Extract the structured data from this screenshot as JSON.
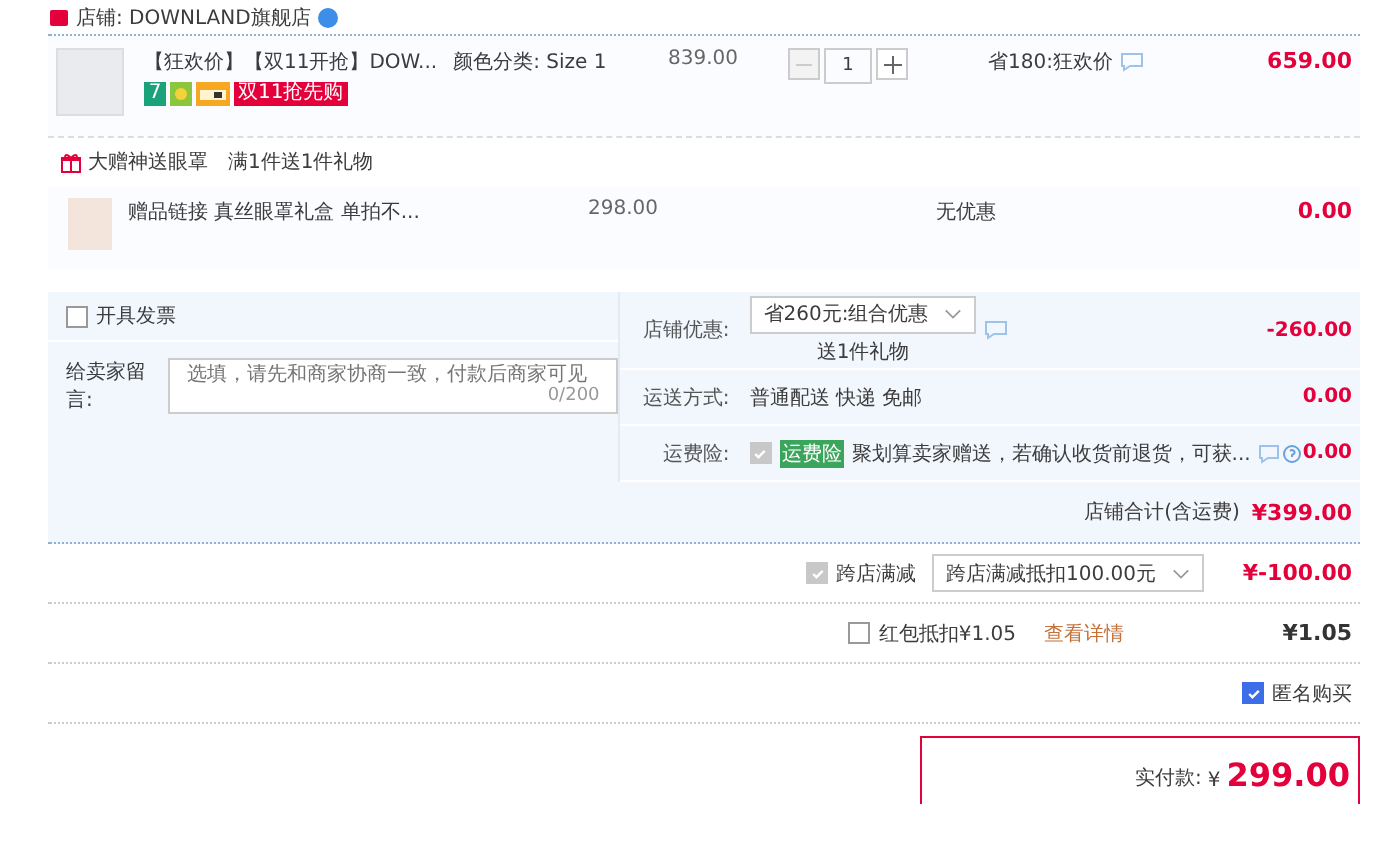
{
  "store": {
    "label": "店铺: DOWNLAND旗舰店"
  },
  "items": [
    {
      "kind": "product",
      "title": "【狂欢价】【双11开抢】DOW...",
      "spec": "颜色分类: Size 1",
      "badge_number": "7",
      "promo_tag": "双11抢先购",
      "price": "839.00",
      "quantity": "1",
      "decrease_disabled": true,
      "discount": "省180:狂欢价",
      "total": "659.00"
    }
  ],
  "gift": {
    "title": "大赠神送眼罩",
    "rule": "满1件送1件礼物",
    "items": [
      {
        "kind": "gift",
        "title": "赠品链接 真丝眼罩礼盒 单拍不...",
        "price": "298.00",
        "discount": "无优惠",
        "total": "0.00"
      }
    ]
  },
  "invoice": {
    "label": "开具发票",
    "checked": false
  },
  "message": {
    "label": "给卖家留言:",
    "placeholder": "选填，请先和商家协商一致，付款后商家可见",
    "counter": "0/200"
  },
  "options": [
    {
      "kind": "select",
      "label": "店铺优惠:",
      "value": "省260元:组合优惠",
      "note": "送1件礼物",
      "amount": "-260.00"
    },
    {
      "kind": "text",
      "label": "运送方式:",
      "value": "普通配送 快递 免邮",
      "amount": "0.00"
    },
    {
      "kind": "insurance",
      "label": "运费险:",
      "checked": true,
      "disabled": true,
      "tag": "运费险",
      "value": "聚划算卖家赠送，若确认收货前退货，可获...",
      "amount": "0.00"
    }
  ],
  "store_total": {
    "label": "店铺合计(含运费)",
    "amount": "¥399.00"
  },
  "cross_store": {
    "label": "跨店满减",
    "checked": true,
    "disabled": true,
    "value": "跨店满减抵扣100.00元",
    "amount": "¥-100.00"
  },
  "red_packet": {
    "label": "红包抵扣¥1.05",
    "checked": false,
    "link": "查看详情",
    "amount": "¥1.05"
  },
  "anonymous": {
    "label": "匿名购买",
    "checked": true
  },
  "payment": {
    "label": "实付款:",
    "currency": "¥",
    "amount": "299.00"
  }
}
